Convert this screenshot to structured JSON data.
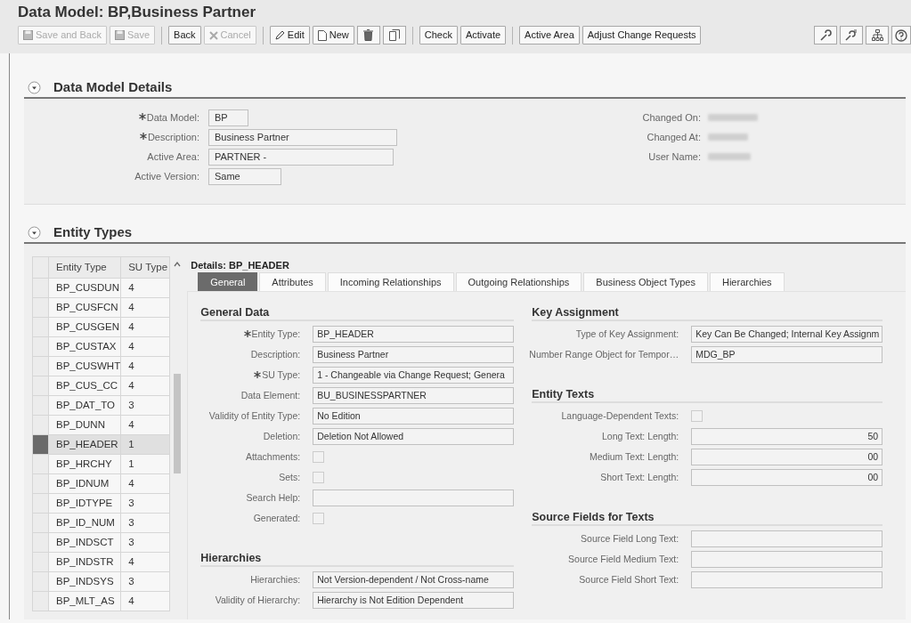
{
  "title": "Data Model: BP,Business Partner",
  "toolbar": [
    {
      "label": "Save and Back",
      "disabled": true
    },
    {
      "label": "Save",
      "disabled": true
    },
    {
      "label": "Back",
      "disabled": false
    },
    {
      "label": "Cancel",
      "disabled": true
    },
    {
      "label": "Edit",
      "disabled": false
    },
    {
      "label": "New",
      "disabled": false
    },
    {
      "label": "Check",
      "disabled": false
    },
    {
      "label": "Activate",
      "disabled": false
    },
    {
      "label": "Active Area",
      "disabled": false
    },
    {
      "label": "Adjust Change Requests",
      "disabled": false
    }
  ],
  "model_details": {
    "heading": "Data Model Details",
    "expanded": true,
    "fields": [
      {
        "label": "Data Model:",
        "required": true,
        "value": "BP"
      },
      {
        "label": "Description:",
        "required": true,
        "value": "Business Partner"
      },
      {
        "label": "Active Area:",
        "required": false,
        "value": "PARTNER -"
      },
      {
        "label": "Active Version:",
        "required": false,
        "value": "Same"
      }
    ],
    "info": [
      {
        "label": "Changed On:"
      },
      {
        "label": "Changed At:"
      },
      {
        "label": "User Name:"
      }
    ]
  },
  "entity_types": {
    "heading": "Entity Types",
    "expanded": true,
    "columns": [
      "Entity Type",
      "SU Type"
    ],
    "rows": [
      {
        "entity_type": "BP_CUSDUN",
        "su_type": "4",
        "selected": false
      },
      {
        "entity_type": "BP_CUSFCN",
        "su_type": "4",
        "selected": false
      },
      {
        "entity_type": "BP_CUSGEN",
        "su_type": "4",
        "selected": false
      },
      {
        "entity_type": "BP_CUSTAX",
        "su_type": "4",
        "selected": false
      },
      {
        "entity_type": "BP_CUSWHT",
        "su_type": "4",
        "selected": false
      },
      {
        "entity_type": "BP_CUS_CC",
        "su_type": "4",
        "selected": false
      },
      {
        "entity_type": "BP_DAT_TO",
        "su_type": "3",
        "selected": false
      },
      {
        "entity_type": "BP_DUNN",
        "su_type": "4",
        "selected": false
      },
      {
        "entity_type": "BP_HEADER",
        "su_type": "1",
        "selected": true
      },
      {
        "entity_type": "BP_HRCHY",
        "su_type": "1",
        "selected": false
      },
      {
        "entity_type": "BP_IDNUM",
        "su_type": "4",
        "selected": false
      },
      {
        "entity_type": "BP_IDTYPE",
        "su_type": "3",
        "selected": false
      },
      {
        "entity_type": "BP_ID_NUM",
        "su_type": "3",
        "selected": false
      },
      {
        "entity_type": "BP_INDSCT",
        "su_type": "3",
        "selected": false
      },
      {
        "entity_type": "BP_INDSTR",
        "su_type": "4",
        "selected": false
      },
      {
        "entity_type": "BP_INDSYS",
        "su_type": "3",
        "selected": false
      },
      {
        "entity_type": "BP_MLT_AS",
        "su_type": "4",
        "selected": false
      }
    ]
  },
  "details": {
    "title": "Details: BP_HEADER",
    "tabs": [
      {
        "label": "General",
        "selected": true
      },
      {
        "label": "Attributes",
        "selected": false
      },
      {
        "label": "Incoming Relationships",
        "selected": false
      },
      {
        "label": "Outgoing Relationships",
        "selected": false
      },
      {
        "label": "Business Object Types",
        "selected": false
      },
      {
        "label": "Hierarchies",
        "selected": false
      }
    ],
    "left_sections": [
      {
        "heading": "General Data",
        "fields": [
          {
            "kind": "field",
            "label": "Entity Type:",
            "required": true,
            "value": "BP_HEADER"
          },
          {
            "kind": "field",
            "label": "Description:",
            "required": false,
            "value": "Business Partner"
          },
          {
            "kind": "field",
            "label": "SU Type:",
            "required": true,
            "value": "1 - Changeable via Change Request; Genera"
          },
          {
            "kind": "field",
            "label": "Data Element:",
            "required": false,
            "value": "BU_BUSINESSPARTNER"
          },
          {
            "kind": "field",
            "label": "Validity of Entity Type:",
            "required": false,
            "value": "No Edition"
          },
          {
            "kind": "field",
            "label": "Deletion:",
            "required": false,
            "value": "Deletion Not Allowed"
          },
          {
            "kind": "checkbox",
            "label": "Attachments:",
            "required": false,
            "checked": false
          },
          {
            "kind": "checkbox",
            "label": "Sets:",
            "required": false,
            "checked": false
          },
          {
            "kind": "field",
            "label": "Search Help:",
            "required": false
          },
          {
            "kind": "checkbox",
            "label": "Generated:",
            "required": false,
            "checked": false
          }
        ]
      },
      {
        "heading": "Hierarchies",
        "fields": [
          {
            "kind": "field",
            "label": "Hierarchies:",
            "required": false,
            "value": "Not Version-dependent / Not Cross-name"
          },
          {
            "kind": "field",
            "label": "Validity of Hierarchy:",
            "required": false,
            "value": "Hierarchy is Not Edition Dependent"
          }
        ]
      }
    ],
    "right_sections": [
      {
        "heading": "Key Assignment",
        "fields": [
          {
            "kind": "field",
            "label": "Type of Key Assignment:",
            "required": false,
            "value": "Key Can Be Changed; Internal Key Assignm"
          },
          {
            "kind": "field",
            "label": "Number Range Object for Tempor…",
            "required": false,
            "value": "MDG_BP"
          }
        ]
      },
      {
        "heading": "Entity Texts",
        "fields": [
          {
            "kind": "checkbox",
            "label": "Language-Dependent Texts:",
            "required": false,
            "checked": false
          },
          {
            "kind": "number",
            "label": "Long Text: Length:",
            "required": false,
            "value": "50"
          },
          {
            "kind": "number",
            "label": "Medium Text: Length:",
            "required": false,
            "value": "00"
          },
          {
            "kind": "number",
            "label": "Short Text: Length:",
            "required": false,
            "value": "00"
          }
        ]
      },
      {
        "heading": "Source Fields for Texts",
        "fields": [
          {
            "kind": "field",
            "label": "Source Field Long Text:",
            "required": false
          },
          {
            "kind": "field",
            "label": "Source Field Medium Text:",
            "required": false
          },
          {
            "kind": "field",
            "label": "Source Field Short Text:",
            "required": false
          }
        ]
      }
    ]
  }
}
